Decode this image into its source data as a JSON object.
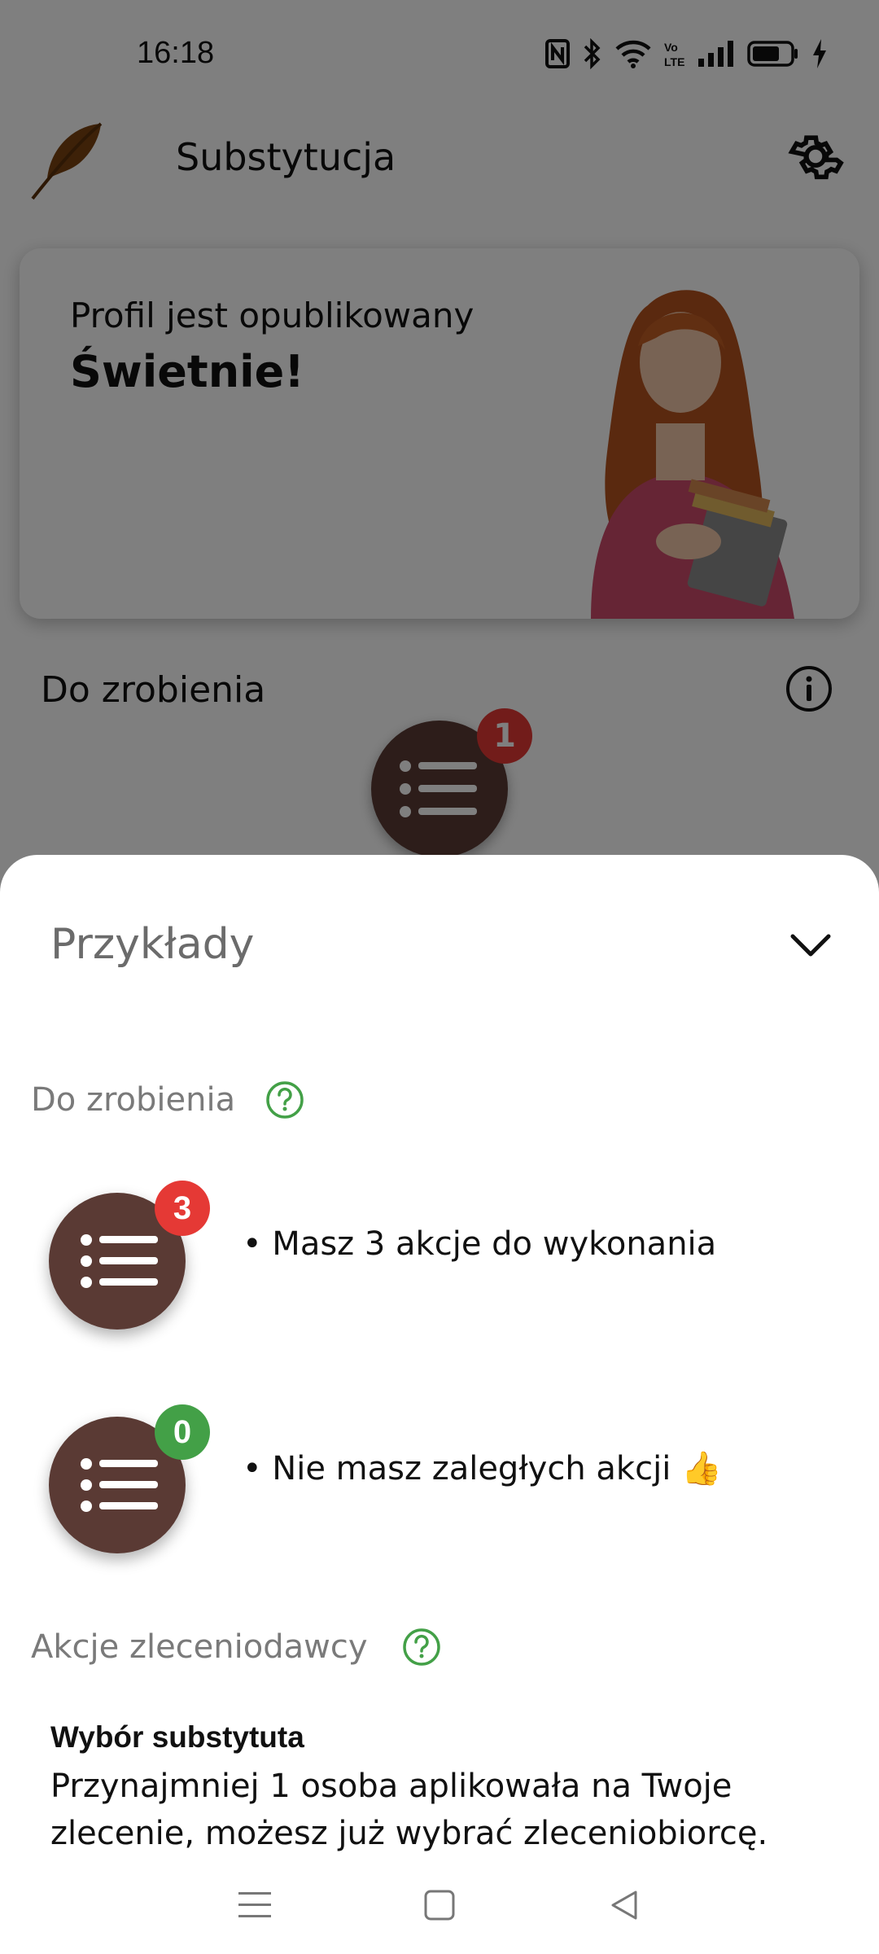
{
  "status": {
    "time": "16:18"
  },
  "app": {
    "title": "Substytucja"
  },
  "hero": {
    "subtitle": "Profil jest opublikowany",
    "title": "Świetnie!"
  },
  "todo": {
    "label": "Do zrobienia",
    "badge": "1"
  },
  "sheet": {
    "title": "Przykłady",
    "section_todo": "Do zrobienia",
    "examples": [
      {
        "badge": "3",
        "badge_color": "#e53935",
        "text": "• Masz 3 akcje do wykonania"
      },
      {
        "badge": "0",
        "badge_color": "#43a047",
        "text": "• Nie masz zaległych akcji 👍"
      }
    ],
    "section_actions": "Akcje zleceniodawcy",
    "action": {
      "title": "Wybór substytuta",
      "description": "Przynajmniej 1 osoba aplikowała na Twoje zlecenie, możesz już wybrać zleceniobiorcę."
    }
  },
  "colors": {
    "fab": "#5a3a34",
    "badge_red": "#e53935",
    "badge_green": "#43a047",
    "help_green": "#43a047"
  }
}
